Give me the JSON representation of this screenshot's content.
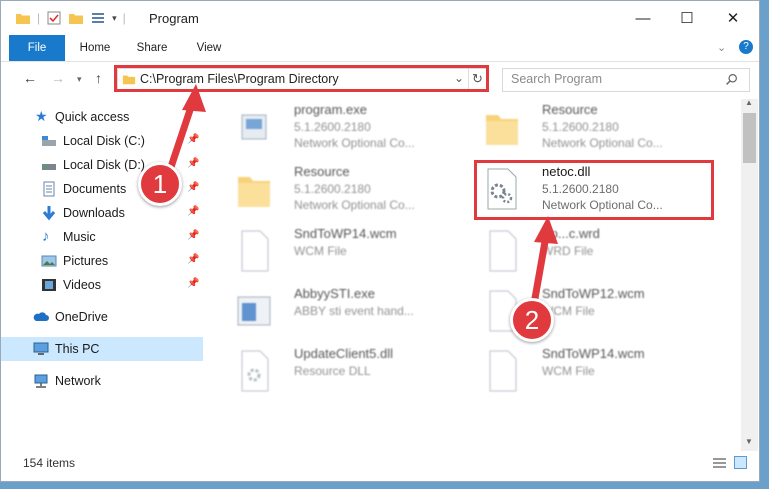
{
  "window": {
    "title": "Program",
    "controls": {
      "minimize": "—",
      "maximize": "☐",
      "close": "✕"
    }
  },
  "ribbon": {
    "tabs": [
      "File",
      "Home",
      "Share",
      "View"
    ]
  },
  "address_bar": {
    "path": "C:\\Program Files\\Program Directory"
  },
  "search": {
    "placeholder": "Search Program"
  },
  "nav_pane": {
    "items": [
      {
        "label": "Quick access",
        "icon": "star-icon"
      },
      {
        "label": "Local Disk (C:)",
        "icon": "drive-icon"
      },
      {
        "label": "Local Disk (D:)",
        "icon": "drive-icon"
      },
      {
        "label": "Documents",
        "icon": "documents-icon"
      },
      {
        "label": "Downloads",
        "icon": "download-icon"
      },
      {
        "label": "Music",
        "icon": "music-icon"
      },
      {
        "label": "Pictures",
        "icon": "pictures-icon"
      },
      {
        "label": "Videos",
        "icon": "videos-icon"
      },
      {
        "label": "OneDrive",
        "icon": "cloud-icon"
      },
      {
        "label": "This PC",
        "icon": "computer-icon"
      },
      {
        "label": "Network",
        "icon": "network-icon"
      }
    ]
  },
  "files": [
    {
      "name": "program.exe",
      "line1": "5.1.2600.2180",
      "line2": "Network Optional Co...",
      "icon": "exe-icon"
    },
    {
      "name": "Resource",
      "line1": "5.1.2600.2180",
      "line2": "Network Optional Co...",
      "icon": "folder-icon"
    },
    {
      "name": "Resource",
      "line1": "5.1.2600.2180",
      "line2": "Network Optional Co...",
      "icon": "folder-icon"
    },
    {
      "name": "netoc.dll",
      "line1": "5.1.2600.2180",
      "line2": "Network Optional Co...",
      "icon": "dll-gear-icon"
    },
    {
      "name": "SndToWP14.wcm",
      "line1": "WCM File",
      "line2": "",
      "icon": "file-icon"
    },
    {
      "name": "Ap...c.wrd",
      "line1": "WRD File",
      "line2": "",
      "icon": "file-icon"
    },
    {
      "name": "AbbyySTI.exe",
      "line1": "ABBY sti event hand...",
      "line2": "",
      "icon": "exe-icon"
    },
    {
      "name": "SndToWP12.wcm",
      "line1": "WCM File",
      "line2": "",
      "icon": "file-icon"
    },
    {
      "name": "UpdateClient5.dll",
      "line1": "Resource DLL",
      "line2": "",
      "icon": "dll-icon"
    },
    {
      "name": "SndToWP14.wcm",
      "line1": "WCM File",
      "line2": "",
      "icon": "file-icon"
    }
  ],
  "status": {
    "count": "154 items"
  },
  "annotations": {
    "step1": "1",
    "step2": "2",
    "accent": "#e0393e"
  }
}
